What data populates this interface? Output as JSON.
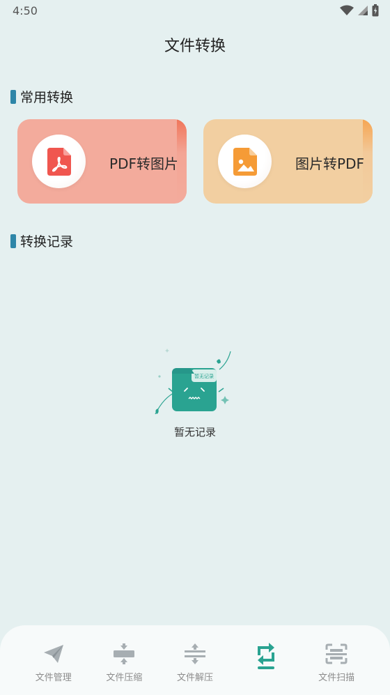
{
  "status_bar": {
    "time": "4:50"
  },
  "header": {
    "title": "文件转换"
  },
  "sections": {
    "common": {
      "label": "常用转换"
    },
    "history": {
      "label": "转换记录"
    }
  },
  "cards": [
    {
      "label": "PDF转图片",
      "icon": "pdf-file-icon",
      "color": "#f3ab9c",
      "accent": "#f0755a"
    },
    {
      "label": "图片转PDF",
      "icon": "image-file-icon",
      "color": "#f2cfa1",
      "accent": "#f6a552"
    }
  ],
  "empty_state": {
    "label": "暂无记录",
    "folder_tag": "暂无记录",
    "icon": "empty-folder-icon",
    "color": "#2aa391"
  },
  "bottom_nav": {
    "active_color": "#2aa391",
    "items": [
      {
        "label": "文件管理",
        "icon": "paper-plane-icon",
        "active": false
      },
      {
        "label": "文件压缩",
        "icon": "compress-icon",
        "active": false
      },
      {
        "label": "文件解压",
        "icon": "decompress-icon",
        "active": false
      },
      {
        "label": "",
        "icon": "convert-icon",
        "active": true
      },
      {
        "label": "文件扫描",
        "icon": "scan-icon",
        "active": false
      }
    ]
  }
}
